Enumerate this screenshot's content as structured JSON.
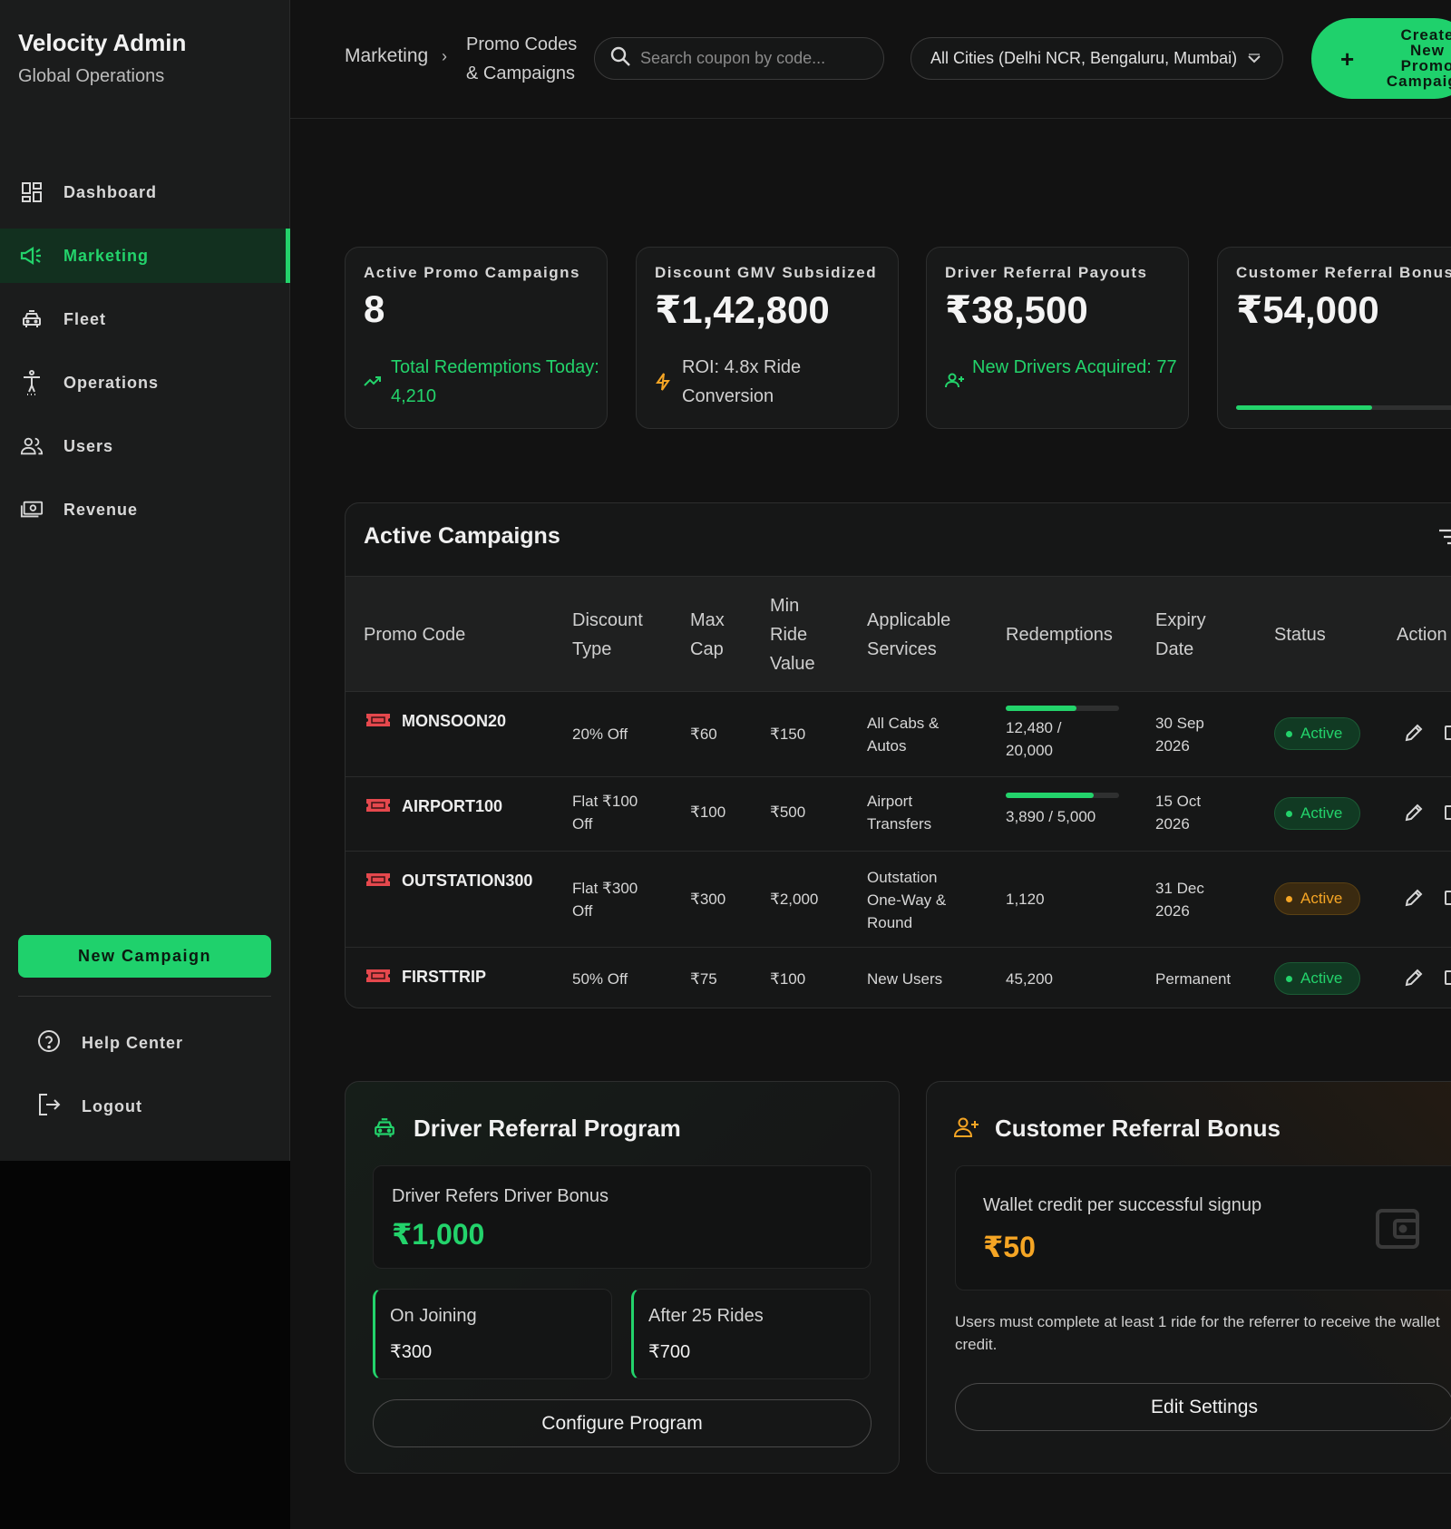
{
  "sidebar": {
    "title": "Velocity Admin",
    "subtitle": "Global Operations",
    "items": [
      {
        "label": "Dashboard",
        "icon": "dashboard-icon"
      },
      {
        "label": "Marketing",
        "icon": "megaphone-icon"
      },
      {
        "label": "Fleet",
        "icon": "car-icon"
      },
      {
        "label": "Operations",
        "icon": "person-standing-icon"
      },
      {
        "label": "Users",
        "icon": "users-icon"
      },
      {
        "label": "Revenue",
        "icon": "cash-icon"
      }
    ],
    "active_item": "Marketing",
    "new_campaign_label": "New Campaign",
    "help_label": "Help Center",
    "logout_label": "Logout"
  },
  "header": {
    "breadcrumb": [
      "Marketing",
      "Promo Codes & Campaigns"
    ],
    "search_placeholder": "Search coupon by code...",
    "city_filter": "All Cities (Delhi NCR, Bengaluru, Mumbai)",
    "create_label": "Create New Promo Campaign"
  },
  "stats": [
    {
      "label": "Active Promo Campaigns",
      "value": "8",
      "note": "Total Redemptions Today: 4,210",
      "note_color": "#23d36b",
      "icon": "trending-up-icon"
    },
    {
      "label": "Discount GMV Subsidized",
      "value": "₹1,42,800",
      "note": "ROI: 4.8x Ride Conversion",
      "note_color": "#d0d0d0",
      "icon": "bolt-icon"
    },
    {
      "label": "Driver Referral Payouts",
      "value": "₹38,500",
      "note": "New Drivers Acquired: 77",
      "note_color": "#23d36b",
      "icon": "user-plus-icon"
    },
    {
      "label": "Customer Referral Bonus",
      "value": "₹54,000",
      "progress": 0.5
    }
  ],
  "campaigns": {
    "title": "Active Campaigns",
    "columns": [
      "Promo Code",
      "Discount Type",
      "Max Cap",
      "Min Ride Value",
      "Applicable Services",
      "Redemptions",
      "Expiry Date",
      "Status",
      "Action"
    ],
    "rows": [
      {
        "code": "MONSOON20",
        "discount": "20% Off",
        "max_cap": "₹60",
        "min_ride": "₹150",
        "services": "All Cabs & Autos",
        "redemptions": "12,480 / 20,000",
        "redemption_progress": 0.624,
        "expiry": "30 Sep 2026",
        "status": "Active",
        "status_tone": "green"
      },
      {
        "code": "AIRPORT100",
        "discount": "Flat ₹100 Off",
        "max_cap": "₹100",
        "min_ride": "₹500",
        "services": "Airport Transfers",
        "redemptions": "3,890 / 5,000",
        "redemption_progress": 0.778,
        "expiry": "15 Oct 2026",
        "status": "Active",
        "status_tone": "green"
      },
      {
        "code": "OUTSTATION300",
        "discount": "Flat ₹300 Off",
        "max_cap": "₹300",
        "min_ride": "₹2,000",
        "services": "Outstation One-Way & Round",
        "redemptions": "1,120",
        "expiry": "31 Dec 2026",
        "status": "Active",
        "status_tone": "amber"
      },
      {
        "code": "FIRSTTRIP",
        "discount": "50% Off",
        "max_cap": "₹75",
        "min_ride": "₹100",
        "services": "New Users",
        "redemptions": "45,200",
        "expiry": "Permanent",
        "status": "Active",
        "status_tone": "green"
      }
    ]
  },
  "driver_referral": {
    "title": "Driver Referral Program",
    "bonus_label": "Driver Refers Driver Bonus",
    "bonus_value": "₹1,000",
    "split": [
      {
        "label": "On Joining",
        "value": "₹300"
      },
      {
        "label": "After 25 Rides",
        "value": "₹700"
      }
    ],
    "button_label": "Configure Program"
  },
  "customer_referral": {
    "title": "Customer Referral Bonus",
    "credit_label": "Wallet credit per successful signup",
    "credit_value": "₹50",
    "note": "Users must complete at least 1 ride for the referrer to receive the wallet credit.",
    "button_label": "Edit Settings"
  },
  "colors": {
    "accent": "#23d36b",
    "warning": "#f5a524",
    "coupon": "#e5484d"
  }
}
